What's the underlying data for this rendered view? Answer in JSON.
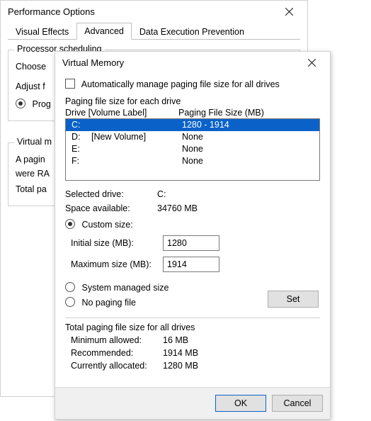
{
  "perf": {
    "title": "Performance Options",
    "tabs": [
      "Visual Effects",
      "Advanced",
      "Data Execution Prevention"
    ],
    "proc_sched_title": "Processor scheduling",
    "choose_line": "Choose",
    "adjust_line": "Adjust f",
    "radio_programs": "Prog",
    "vm_group_title": "Virtual m",
    "vm_desc_line1": "A pagin",
    "vm_desc_line2": "were RA",
    "total_line": "Total pa"
  },
  "vm": {
    "title": "Virtual Memory",
    "auto_manage": "Automatically manage paging file size for all drives",
    "each_drive": "Paging file size for each drive",
    "col_drive": "Drive  [Volume Label]",
    "col_pfs": "Paging File Size (MB)",
    "drives": [
      {
        "letter": "C:",
        "label": "",
        "pfs": "1280 - 1914",
        "selected": true
      },
      {
        "letter": "D:",
        "label": "[New Volume]",
        "pfs": "None"
      },
      {
        "letter": "E:",
        "label": "",
        "pfs": "None"
      },
      {
        "letter": "F:",
        "label": "",
        "pfs": "None"
      }
    ],
    "selected_drive_k": "Selected drive:",
    "selected_drive_v": "C:",
    "space_avail_k": "Space available:",
    "space_avail_v": "34760 MB",
    "custom_size": "Custom size:",
    "initial_k": "Initial size (MB):",
    "initial_v": "1280",
    "max_k": "Maximum size (MB):",
    "max_v": "1914",
    "sys_managed": "System managed size",
    "no_paging": "No paging file",
    "set_btn": "Set",
    "totals_title": "Total paging file size for all drives",
    "min_k": "Minimum allowed:",
    "min_v": "16 MB",
    "rec_k": "Recommended:",
    "rec_v": "1914 MB",
    "cur_k": "Currently allocated:",
    "cur_v": "1280 MB",
    "ok": "OK",
    "cancel": "Cancel"
  }
}
